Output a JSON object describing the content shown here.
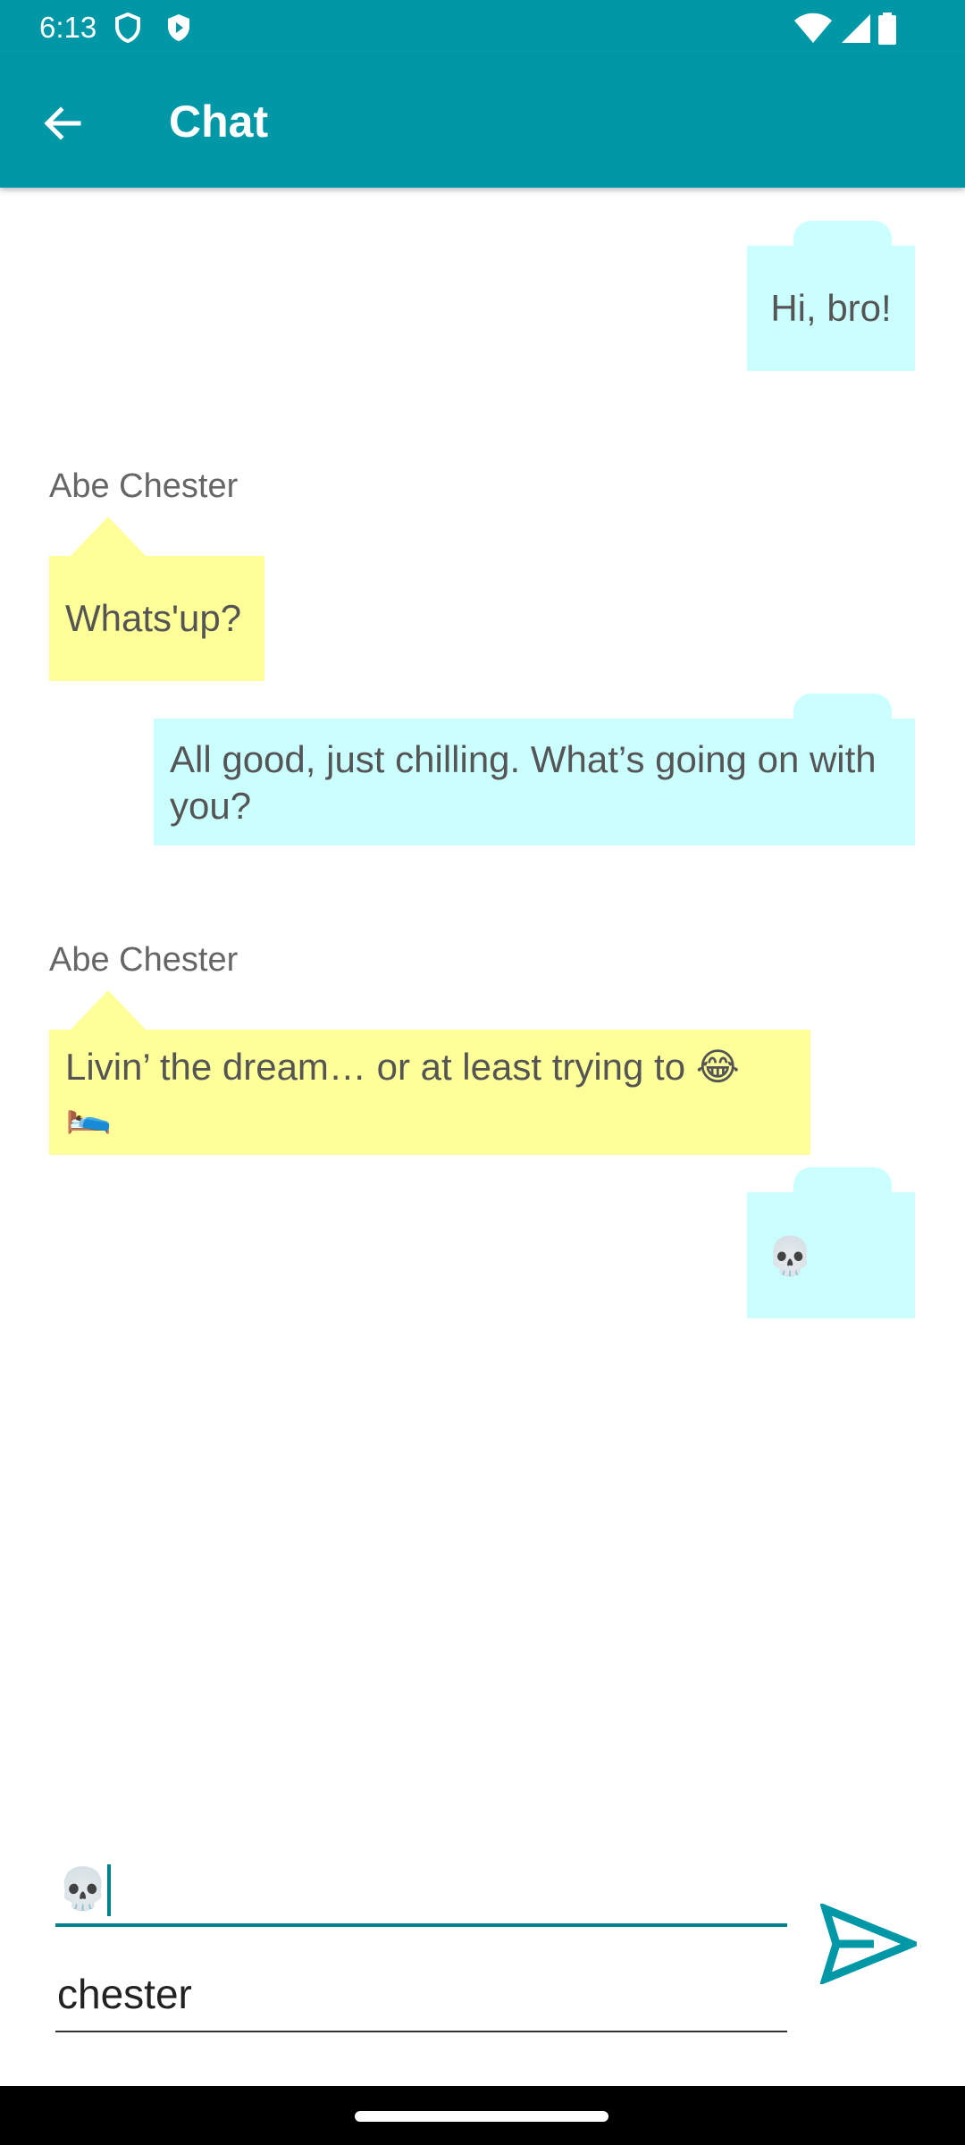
{
  "status_bar": {
    "time": "6:13"
  },
  "app_bar": {
    "title": "Chat"
  },
  "messages": [
    {
      "from": "me",
      "text": "Hi, bro!"
    },
    {
      "from": "them",
      "sender": "Abe Chester",
      "text": "Whats'up?"
    },
    {
      "from": "me",
      "text": "All good, just chilling. What’s going on with you?"
    },
    {
      "from": "them",
      "sender": "Abe Chester",
      "text": "Livin’ the dream… or at least trying to 😂 🛌"
    },
    {
      "from": "me",
      "text": "💀"
    }
  ],
  "composer": {
    "message_value": "💀",
    "username_value": "chester"
  },
  "colors": {
    "primary": "#0097a7",
    "my_bubble": "#cbffff",
    "their_bubble": "#ffff99"
  }
}
